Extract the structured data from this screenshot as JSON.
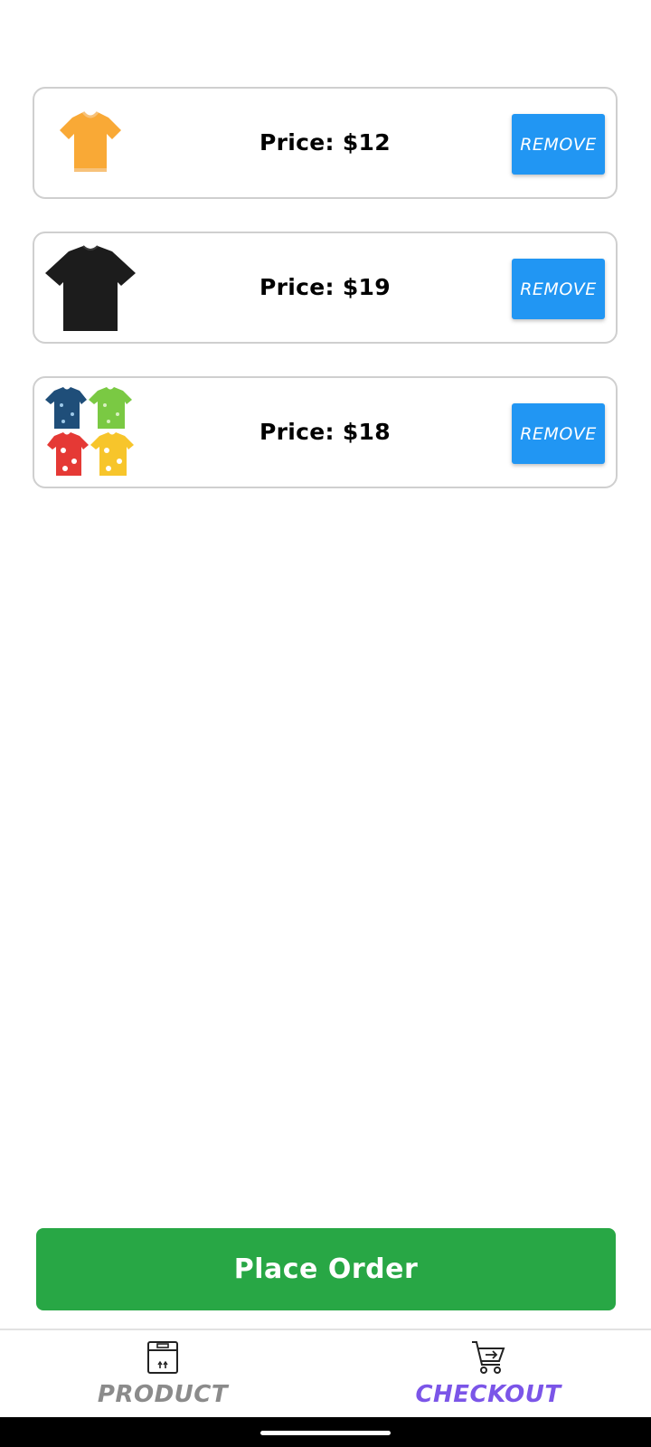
{
  "cart": {
    "items": [
      {
        "image_icon": "yellow-tshirt-icon",
        "price_label": "Price: $12",
        "remove_label": "REMOVE"
      },
      {
        "image_icon": "black-tshirt-icon",
        "price_label": "Price: $19",
        "remove_label": "REMOVE"
      },
      {
        "image_icon": "hawaiian-shirts-icon",
        "price_label": "Price: $18",
        "remove_label": "REMOVE"
      }
    ]
  },
  "place_order": {
    "label": "Place Order"
  },
  "bottom_nav": {
    "items": [
      {
        "label": "PRODUCT",
        "icon": "box-icon",
        "active": false
      },
      {
        "label": "CHECKOUT",
        "icon": "cart-icon",
        "active": true
      }
    ]
  },
  "colors": {
    "remove_button": "#2196f3",
    "place_order_button": "#28a745",
    "nav_active": "#7b55e8",
    "nav_inactive": "#8b8b8b"
  }
}
